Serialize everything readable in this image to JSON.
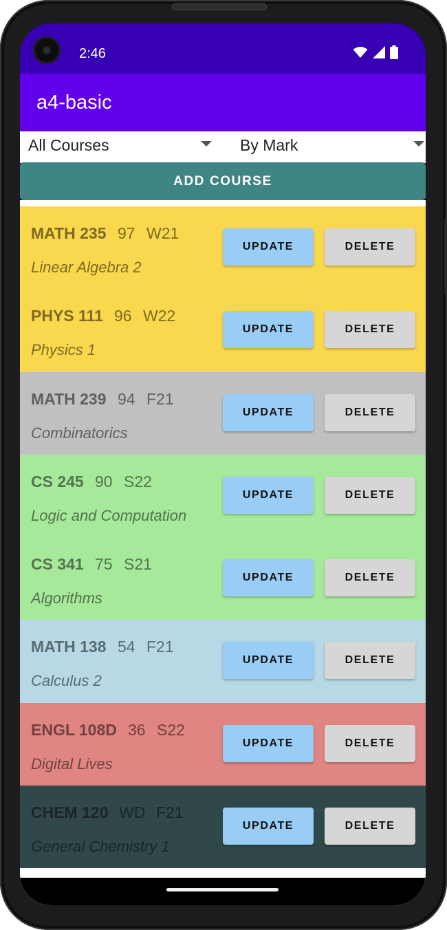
{
  "status_bar": {
    "time": "2:46",
    "icons": [
      "wifi-icon",
      "cell-signal-icon",
      "battery-icon"
    ]
  },
  "app_bar": {
    "title": "a4-basic"
  },
  "filters": {
    "term_filter": {
      "selected": "All Courses"
    },
    "sort_filter": {
      "selected": "By Mark"
    }
  },
  "add_course": {
    "label": "ADD COURSE"
  },
  "buttons": {
    "update_label": "UPDATE",
    "delete_label": "DELETE"
  },
  "colors": {
    "status_bar": "#3700b3",
    "app_bar": "#6200ee",
    "add_button": "#3e8583",
    "update_button": "#9acdf5",
    "delete_button": "#d6d6d6"
  },
  "courses": [
    {
      "code": "MATH 235",
      "mark": "97",
      "term": "W21",
      "description": "Linear Algebra 2",
      "bg": "#f9d84d",
      "fg": "#7d6a22"
    },
    {
      "code": "PHYS 111",
      "mark": "96",
      "term": "W22",
      "description": "Physics 1",
      "bg": "#f9d84d",
      "fg": "#7d6a22"
    },
    {
      "code": "MATH 239",
      "mark": "94",
      "term": "F21",
      "description": "Combinatorics",
      "bg": "#c0c0c0",
      "fg": "#606060"
    },
    {
      "code": "CS 245",
      "mark": "90",
      "term": "S22",
      "description": "Logic and Computation",
      "bg": "#a6e99b",
      "fg": "#52744d"
    },
    {
      "code": "CS 341",
      "mark": "75",
      "term": "S21",
      "description": "Algorithms",
      "bg": "#a6e99b",
      "fg": "#52744d"
    },
    {
      "code": "MATH 138",
      "mark": "54",
      "term": "F21",
      "description": "Calculus 2",
      "bg": "#b7d8e4",
      "fg": "#5a6c72"
    },
    {
      "code": "ENGL 108D",
      "mark": "36",
      "term": "S22",
      "description": "Digital Lives",
      "bg": "#e08581",
      "fg": "#6f4240"
    },
    {
      "code": "CHEM 120",
      "mark": "WD",
      "term": "F21",
      "description": "General Chemistry 1",
      "bg": "#304849",
      "fg": "#1a2526"
    }
  ]
}
